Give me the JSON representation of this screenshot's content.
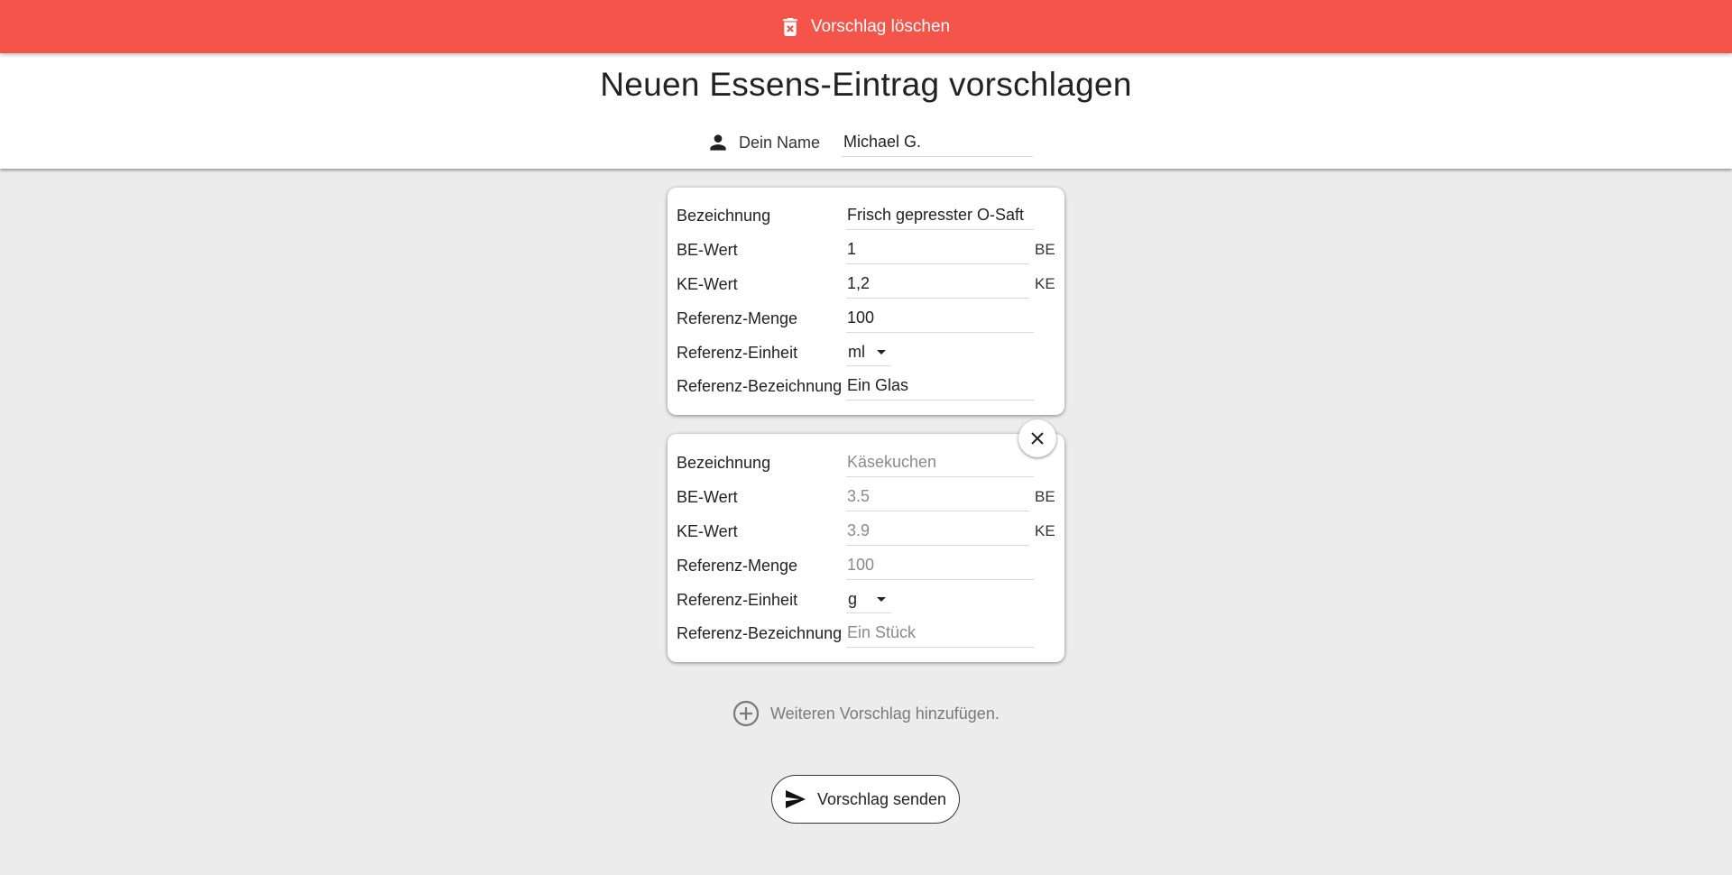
{
  "top_bar": {
    "delete_label": "Vorschlag löschen",
    "icon": "trash-icon",
    "color": "#f4544a"
  },
  "header": {
    "title": "Neuen Essens-Eintrag vorschlagen",
    "name_label": "Dein Name",
    "name_value": "Michael G.",
    "name_icon": "person-icon"
  },
  "labels": {
    "bezeichnung": "Bezeichnung",
    "be_wert": "BE-Wert",
    "ke_wert": "KE-Wert",
    "referenz_menge": "Referenz-Menge",
    "referenz_einheit": "Referenz-Einheit",
    "referenz_bezeichnung": "Referenz-Bezeichnung",
    "be_unit": "BE",
    "ke_unit": "KE"
  },
  "entries": [
    {
      "bezeichnung": "Frisch gepresster O-Saft",
      "be_wert": "1",
      "ke_wert": "1,2",
      "referenz_menge": "100",
      "referenz_einheit": "ml",
      "referenz_bezeichnung": "Ein Glas"
    },
    {
      "bezeichnung": "",
      "be_wert": "",
      "ke_wert": "",
      "referenz_menge": "",
      "referenz_einheit": "g",
      "referenz_bezeichnung": "",
      "placeholders": {
        "bezeichnung": "Käsekuchen",
        "be_wert": "3.5",
        "ke_wert": "3.9",
        "referenz_menge": "100",
        "referenz_bezeichnung": "Ein Stück"
      }
    }
  ],
  "add_more_label": "Weiteren Vorschlag hinzufügen.",
  "send_label": "Vorschlag senden"
}
